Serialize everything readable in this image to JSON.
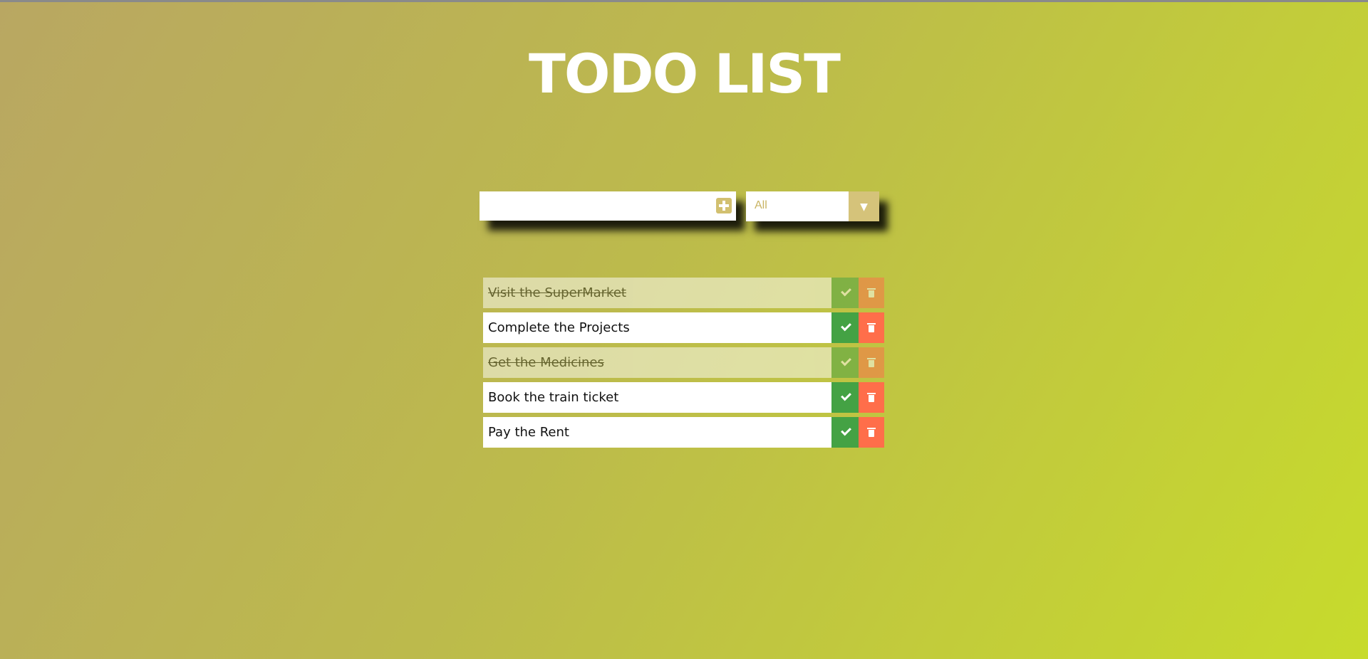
{
  "page": {
    "title": "TODO LIST"
  },
  "form": {
    "input_value": "",
    "input_placeholder": "",
    "add_icon": "plus-square-icon",
    "filter_selected": "All",
    "filter_arrow_icon": "triangle-down-icon"
  },
  "todos": [
    {
      "text": "Visit the SuperMarket",
      "completed": true
    },
    {
      "text": "Complete the Projects",
      "completed": false
    },
    {
      "text": "Get the Medicines",
      "completed": true
    },
    {
      "text": "Book the train ticket",
      "completed": false
    },
    {
      "text": "Pay the Rent",
      "completed": false
    }
  ],
  "colors": {
    "check": "#44a244",
    "trash": "#ff6e4a",
    "accent": "#d5c37a"
  }
}
